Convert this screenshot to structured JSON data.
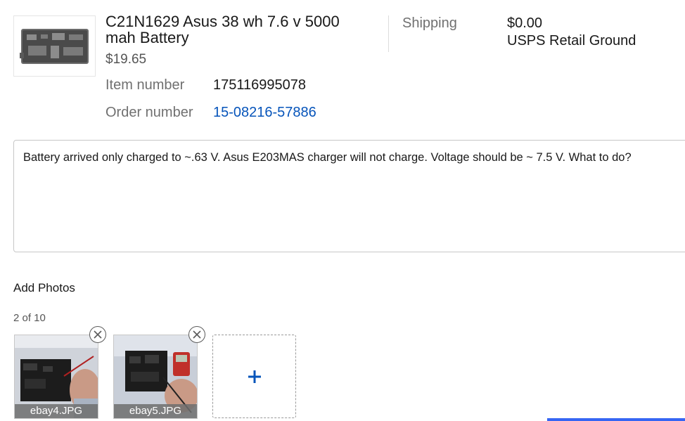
{
  "item": {
    "title": "C21N1629 Asus 38 wh 7.6 v 5000 mah Battery",
    "price": "$19.65",
    "item_number_label": "Item number",
    "item_number": "175116995078",
    "order_number_label": "Order number",
    "order_number": "15-08216-57886",
    "image_icon": "battery-photo-icon"
  },
  "shipping": {
    "label": "Shipping",
    "price": "$0.00",
    "method": "USPS Retail Ground"
  },
  "message": {
    "text": "Battery arrived only charged to ~.63 V.  Asus E203MAS  charger will not charge.  Voltage should be ~ 7.5 V.  What to do?"
  },
  "photos": {
    "heading": "Add Photos",
    "counter": "2 of 10",
    "items": [
      {
        "filename": "ebay4.JPG"
      },
      {
        "filename": "ebay5.JPG"
      }
    ],
    "add_icon": "plus-icon",
    "remove_icon": "close-circle-icon"
  },
  "colors": {
    "link": "#0654ba",
    "accent": "#3665f3",
    "muted_text": "#707070"
  }
}
